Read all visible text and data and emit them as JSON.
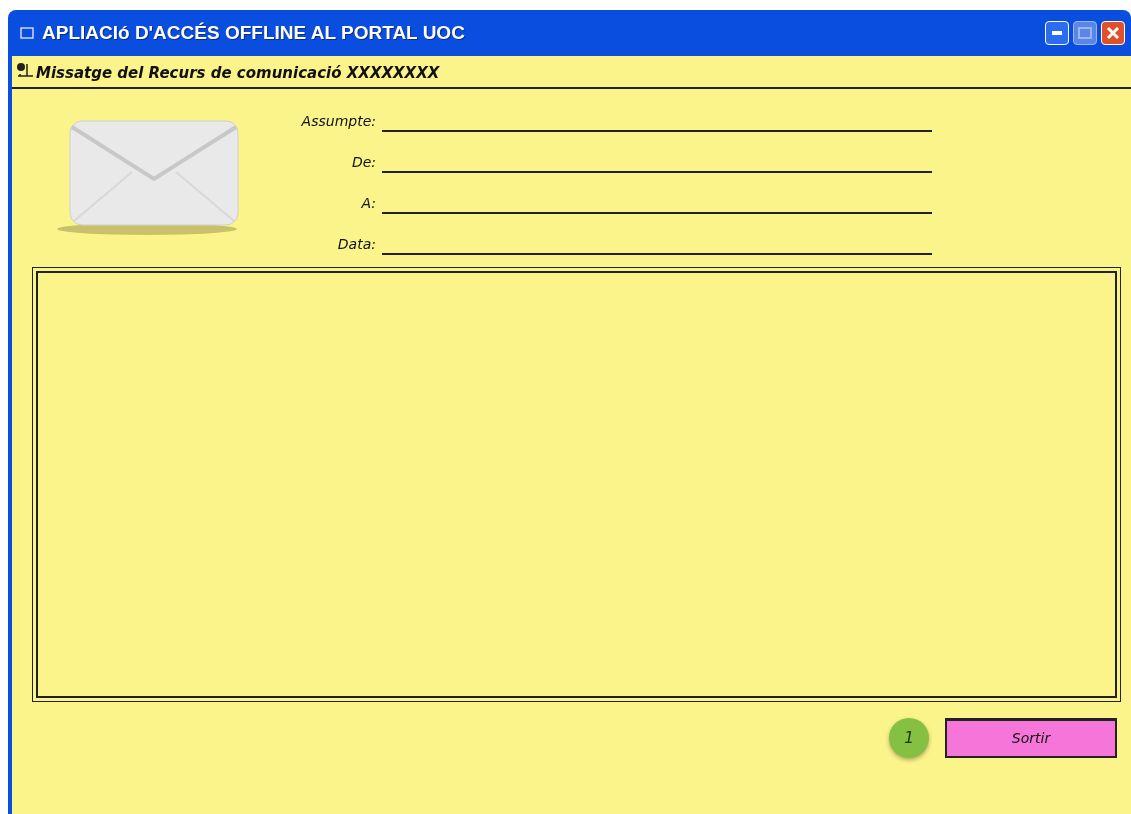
{
  "window": {
    "title": "APLIACIó D'ACCÉS OFFLINE AL PORTAL UOC"
  },
  "header": {
    "title": "Missatge del Recurs de comunicació XXXXXXXX"
  },
  "fields": [
    {
      "label": "Assumpte:"
    },
    {
      "label": "De:"
    },
    {
      "label": "A:"
    },
    {
      "label": "Data:"
    }
  ],
  "badge": "1",
  "buttons": [
    "Sortir"
  ]
}
